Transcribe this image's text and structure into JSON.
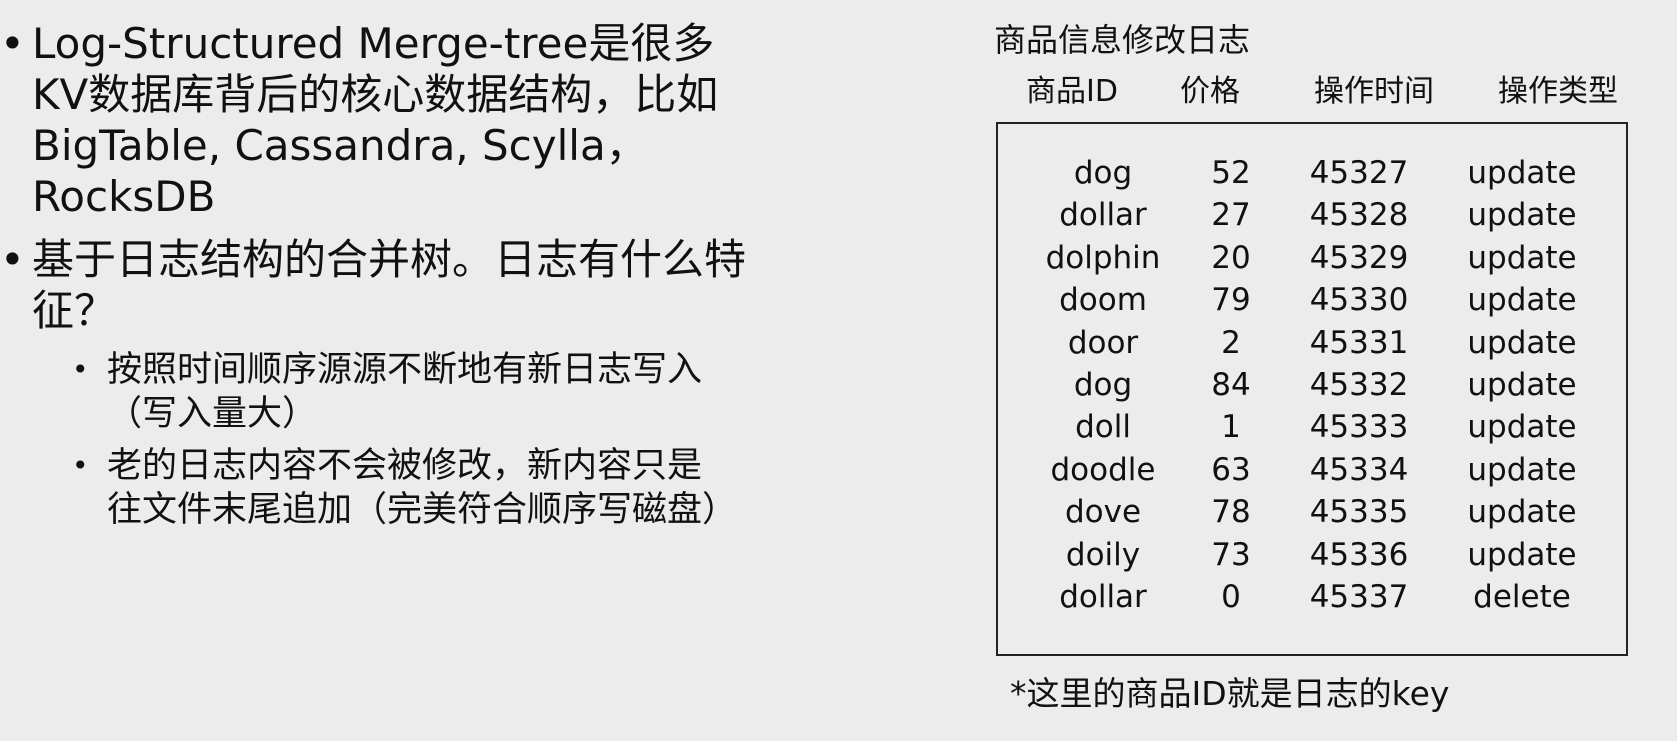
{
  "bullets": [
    {
      "text": "Log-Structured Merge-tree是很多KV数据库背后的核心数据结构，比如BigTable, Cassandra, Scylla，RocksDB"
    },
    {
      "text": "基于日志结构的合并树。日志有什么特征？",
      "subs": [
        "按照时间顺序源源不断地有新日志写入（写入量大）",
        "老的日志内容不会被修改，新内容只是往文件末尾追加（完美符合顺序写磁盘）"
      ]
    }
  ],
  "log": {
    "title": "商品信息修改日志",
    "headers": [
      "商品ID",
      "价格",
      "操作时间",
      "操作类型"
    ],
    "rows": [
      [
        "dog",
        "52",
        "45327",
        "update"
      ],
      [
        "dollar",
        "27",
        "45328",
        "update"
      ],
      [
        "dolphin",
        "20",
        "45329",
        "update"
      ],
      [
        "doom",
        "79",
        "45330",
        "update"
      ],
      [
        "door",
        "2",
        "45331",
        "update"
      ],
      [
        "dog",
        "84",
        "45332",
        "update"
      ],
      [
        "doll",
        "1",
        "45333",
        "update"
      ],
      [
        "doodle",
        "63",
        "45334",
        "update"
      ],
      [
        "dove",
        "78",
        "45335",
        "update"
      ],
      [
        "doily",
        "73",
        "45336",
        "update"
      ],
      [
        "dollar",
        "0",
        "45337",
        "delete"
      ]
    ],
    "note": "*这里的商品ID就是日志的key"
  }
}
